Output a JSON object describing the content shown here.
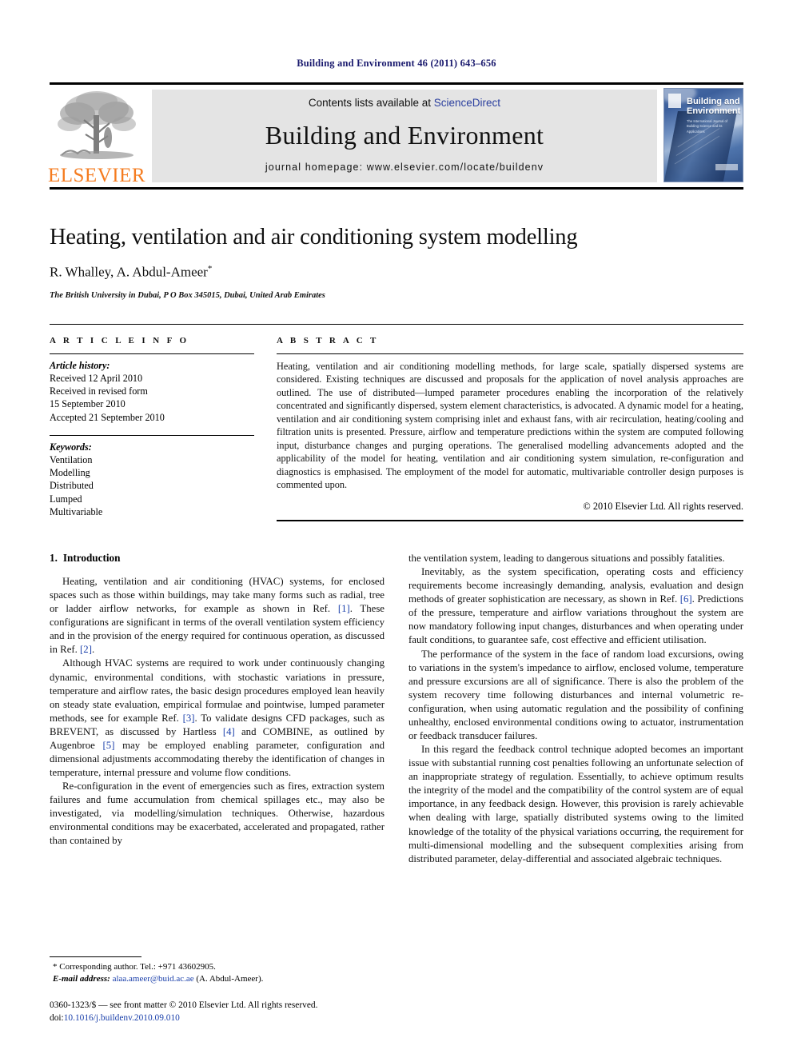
{
  "running_head": "Building and Environment 46 (2011) 643–656",
  "masthead": {
    "publisher_logo_text": "ELSEVIER",
    "contents_prefix": "Contents lists available at",
    "contents_link": "ScienceDirect",
    "journal_title": "Building and Environment",
    "homepage_label": "journal homepage: www.elsevier.com/locate/buildenv",
    "cover": {
      "title_line1": "Building and",
      "title_line2": "Environment",
      "subtitle": "The International Journal of Building Science and its Applications"
    }
  },
  "article": {
    "title": "Heating, ventilation and air conditioning system modelling",
    "authors": "R. Whalley, A. Abdul-Ameer",
    "author_marker": "*",
    "affiliation": "The British University in Dubai, P O Box 345015, Dubai, United Arab Emirates"
  },
  "article_info": {
    "heading": "A R T I C L E  I N F O",
    "history_label": "Article history:",
    "history": [
      "Received 12 April 2010",
      "Received in revised form",
      "15 September 2010",
      "Accepted 21 September 2010"
    ],
    "keywords_label": "Keywords:",
    "keywords": [
      "Ventilation",
      "Modelling",
      "Distributed",
      "Lumped",
      "Multivariable"
    ]
  },
  "abstract": {
    "heading": "A B S T R A C T",
    "text": "Heating, ventilation and air conditioning modelling methods, for large scale, spatially dispersed systems are considered. Existing techniques are discussed and proposals for the application of novel analysis approaches are outlined. The use of distributed—lumped parameter procedures enabling the incorporation of the relatively concentrated and significantly dispersed, system element characteristics, is advocated. A dynamic model for a heating, ventilation and air conditioning system comprising inlet and exhaust fans, with air recirculation, heating/cooling and filtration units is presented. Pressure, airflow and temperature predictions within the system are computed following input, disturbance changes and purging operations. The generalised modelling advancements adopted and the applicability of the model for heating, ventilation and air conditioning system simulation, re-configuration and diagnostics is emphasised. The employment of the model for automatic, multivariable controller design purposes is commented upon.",
    "copyright": "© 2010 Elsevier Ltd. All rights reserved."
  },
  "sections": {
    "intro_number": "1.",
    "intro_title": "Introduction"
  },
  "left_column": {
    "p1_a": "Heating, ventilation and air conditioning (HVAC) systems, for enclosed spaces such as those within buildings, may take many forms such as radial, tree or ladder airflow networks, for example as shown in Ref. ",
    "p1_ref1": "[1]",
    "p1_b": ". These configurations are significant in terms of the overall ventilation system efficiency and in the provision of the energy required for continuous operation, as discussed in Ref. ",
    "p1_ref2": "[2]",
    "p1_c": ".",
    "p2_a": "Although HVAC systems are required to work under continuously changing dynamic, environmental conditions, with stochastic variations in pressure, temperature and airflow rates, the basic design procedures employed lean heavily on steady state evaluation, empirical formulae and pointwise, lumped parameter methods, see for example Ref. ",
    "p2_ref3": "[3]",
    "p2_b": ". To validate designs CFD packages, such as BREVENT, as discussed by Hartless ",
    "p2_ref4": "[4]",
    "p2_c": " and COMBINE, as outlined by Augenbroe ",
    "p2_ref5": "[5]",
    "p2_d": " may be employed enabling parameter, configuration and dimensional adjustments accommodating thereby the identification of changes in temperature, internal pressure and volume flow conditions.",
    "p3": "Re-configuration in the event of emergencies such as fires, extraction system failures and fume accumulation from chemical spillages etc., may also be investigated, via modelling/simulation techniques. Otherwise, hazardous environmental conditions may be exacerbated, accelerated and propagated, rather than contained by"
  },
  "right_column": {
    "p1": "the ventilation system, leading to dangerous situations and possibly fatalities.",
    "p2_a": "Inevitably, as the system specification, operating costs and efficiency requirements become increasingly demanding, analysis, evaluation and design methods of greater sophistication are necessary, as shown in Ref. ",
    "p2_ref6": "[6]",
    "p2_b": ". Predictions of the pressure, temperature and airflow variations throughout the system are now mandatory following input changes, disturbances and when operating under fault conditions, to guarantee safe, cost effective and efficient utilisation.",
    "p3": "The performance of the system in the face of random load excursions, owing to variations in the system's impedance to airflow, enclosed volume, temperature and pressure excursions are all of significance. There is also the problem of the system recovery time following disturbances and internal volumetric re-configuration, when using automatic regulation and the possibility of confining unhealthy, enclosed environmental conditions owing to actuator, instrumentation or feedback transducer failures.",
    "p4": "In this regard the feedback control technique adopted becomes an important issue with substantial running cost penalties following an unfortunate selection of an inappropriate strategy of regulation. Essentially, to achieve optimum results the integrity of the model and the compatibility of the control system are of equal importance, in any feedback design. However, this provision is rarely achievable when dealing with large, spatially distributed systems owing to the limited knowledge of the totality of the physical variations occurring, the requirement for multi-dimensional modelling and the subsequent complexities arising from distributed parameter, delay-differential and associated algebraic techniques."
  },
  "footnote": {
    "corresponding": "* Corresponding author. Tel.: +971 43602905.",
    "email_label": "E-mail address:",
    "email": "alaa.ameer@buid.ac.ae",
    "email_suffix": "(A. Abdul-Ameer).",
    "issn_line": "0360-1323/$ — see front matter © 2010 Elsevier Ltd. All rights reserved.",
    "doi_label": "doi:",
    "doi": "10.1016/j.buildenv.2010.09.010"
  },
  "colors": {
    "running_head": "#1a1a6e",
    "link": "#1a3faa",
    "elsevier_orange": "#F57C20",
    "panel_grey": "#e4e4e4"
  }
}
